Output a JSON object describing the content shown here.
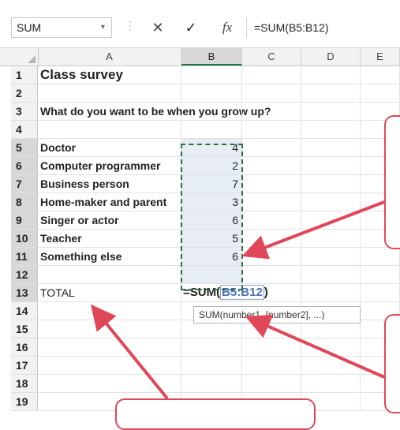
{
  "formula_bar": {
    "name_box": "SUM",
    "name_box_arrow": "▾",
    "dots": "⋮",
    "cancel": "✕",
    "enter": "✓",
    "fx": "fx",
    "formula": "=SUM(B5:B12)"
  },
  "columns": [
    "A",
    "B",
    "C",
    "D",
    "E"
  ],
  "rows": [
    {
      "n": "1",
      "a": "Class survey",
      "b": ""
    },
    {
      "n": "2",
      "a": "",
      "b": ""
    },
    {
      "n": "3",
      "a": "What do you want to be when you grow up?",
      "b": ""
    },
    {
      "n": "4",
      "a": "",
      "b": ""
    },
    {
      "n": "5",
      "a": "Doctor",
      "b": "4"
    },
    {
      "n": "6",
      "a": "Computer programmer",
      "b": "2"
    },
    {
      "n": "7",
      "a": "Business person",
      "b": "7"
    },
    {
      "n": "8",
      "a": "Home-maker and parent",
      "b": "3"
    },
    {
      "n": "9",
      "a": "Singer or actor",
      "b": "6"
    },
    {
      "n": "10",
      "a": "Teacher",
      "b": "5"
    },
    {
      "n": "11",
      "a": "Something else",
      "b": "6"
    },
    {
      "n": "12",
      "a": "",
      "b": ""
    },
    {
      "n": "13",
      "a": "TOTAL",
      "b": ""
    },
    {
      "n": "14",
      "a": "",
      "b": ""
    },
    {
      "n": "15",
      "a": "",
      "b": ""
    },
    {
      "n": "16",
      "a": "",
      "b": ""
    },
    {
      "n": "17",
      "a": "",
      "b": ""
    },
    {
      "n": "18",
      "a": "",
      "b": ""
    },
    {
      "n": "19",
      "a": "",
      "b": ""
    }
  ],
  "editing_cell": {
    "prefix": "=SUM(",
    "range": "B5:B12",
    "suffix": ")"
  },
  "tooltip": "SUM(number1, [number2], ...)",
  "colors": {
    "accent": "#217346",
    "callout": "#e0485a",
    "range_ref": "#4a6fb5",
    "selection_fill": "#e6edf5"
  }
}
